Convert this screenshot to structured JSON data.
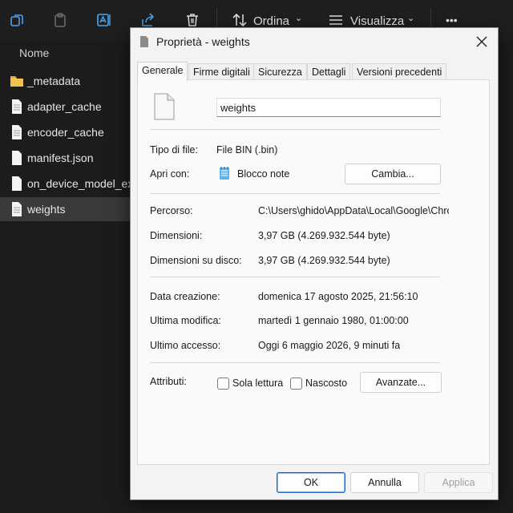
{
  "toolbar": {
    "sort_label": "Ordina",
    "view_label": "Visualizza",
    "more_label": "•••"
  },
  "explorer": {
    "column_name": "Nome",
    "items": [
      {
        "name": "_metadata",
        "type": "folder"
      },
      {
        "name": "adapter_cache",
        "type": "file"
      },
      {
        "name": "encoder_cache",
        "type": "file"
      },
      {
        "name": "manifest.json",
        "type": "file"
      },
      {
        "name": "on_device_model_exe",
        "type": "file"
      },
      {
        "name": "weights",
        "type": "file",
        "selected": true
      }
    ]
  },
  "dialog": {
    "title": "Proprietà - weights",
    "tabs": [
      "Generale",
      "Firme digitali",
      "Sicurezza",
      "Dettagli",
      "Versioni precedenti"
    ],
    "active_tab": "Generale",
    "file_name": "weights",
    "type_label": "Tipo di file:",
    "type_value": "File BIN (.bin)",
    "open_with_label": "Apri con:",
    "open_with_value": "Blocco note",
    "change_button": "Cambia...",
    "path_label": "Percorso:",
    "path_value": "C:\\Users\\ghido\\AppData\\Local\\Google\\Chrome",
    "size_label": "Dimensioni:",
    "size_value": "3,97 GB (4.269.932.544 byte)",
    "disk_size_label": "Dimensioni su disco:",
    "disk_size_value": "3,97 GB (4.269.932.544 byte)",
    "created_label": "Data creazione:",
    "created_value": "domenica 17 agosto 2025, 21:56:10",
    "modified_label": "Ultima modifica:",
    "modified_value": "martedì 1 gennaio 1980, 01:00:00",
    "accessed_label": "Ultimo accesso:",
    "accessed_value": "Oggi 6 maggio 2026, 9 minuti fa",
    "attributes_label": "Attributi:",
    "readonly_label": "Sola lettura",
    "hidden_label": "Nascosto",
    "advanced_button": "Avanzate...",
    "ok_button": "OK",
    "cancel_button": "Annulla",
    "apply_button": "Applica"
  }
}
